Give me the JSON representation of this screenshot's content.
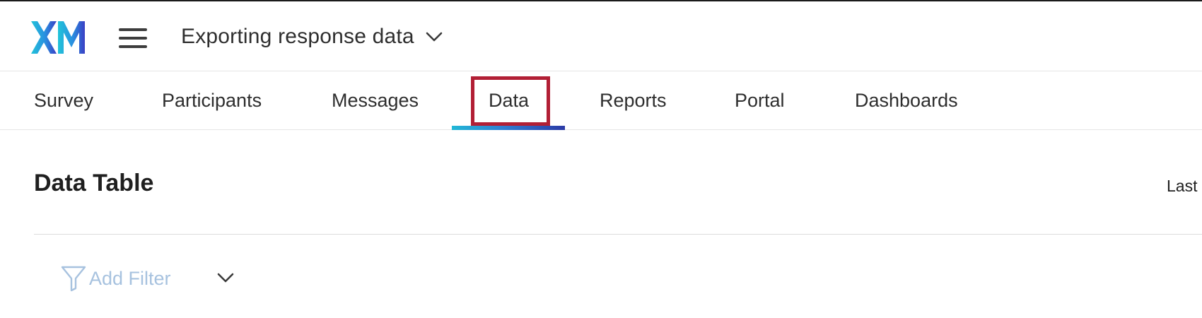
{
  "header": {
    "logo_text": "XM",
    "project_title": "Exporting response data"
  },
  "tabs": [
    {
      "label": "Survey"
    },
    {
      "label": "Participants"
    },
    {
      "label": "Messages"
    },
    {
      "label": "Data",
      "active": true
    },
    {
      "label": "Reports"
    },
    {
      "label": "Portal"
    },
    {
      "label": "Dashboards"
    }
  ],
  "page": {
    "title": "Data Table",
    "right_text": "Last"
  },
  "filter": {
    "add_label": "Add Filter"
  },
  "icons": {
    "logo": "xm-logo-icon",
    "menu": "hamburger-menu-icon",
    "title_dropdown": "chevron-down-icon",
    "filter": "funnel-icon",
    "filter_dropdown": "chevron-down-icon"
  },
  "colors": {
    "active_tab_gradient_start": "#22b8d6",
    "active_tab_gradient_end": "#2c3aa6",
    "highlight_box": "#b21f35",
    "filter_disabled": "#a7c2df"
  }
}
